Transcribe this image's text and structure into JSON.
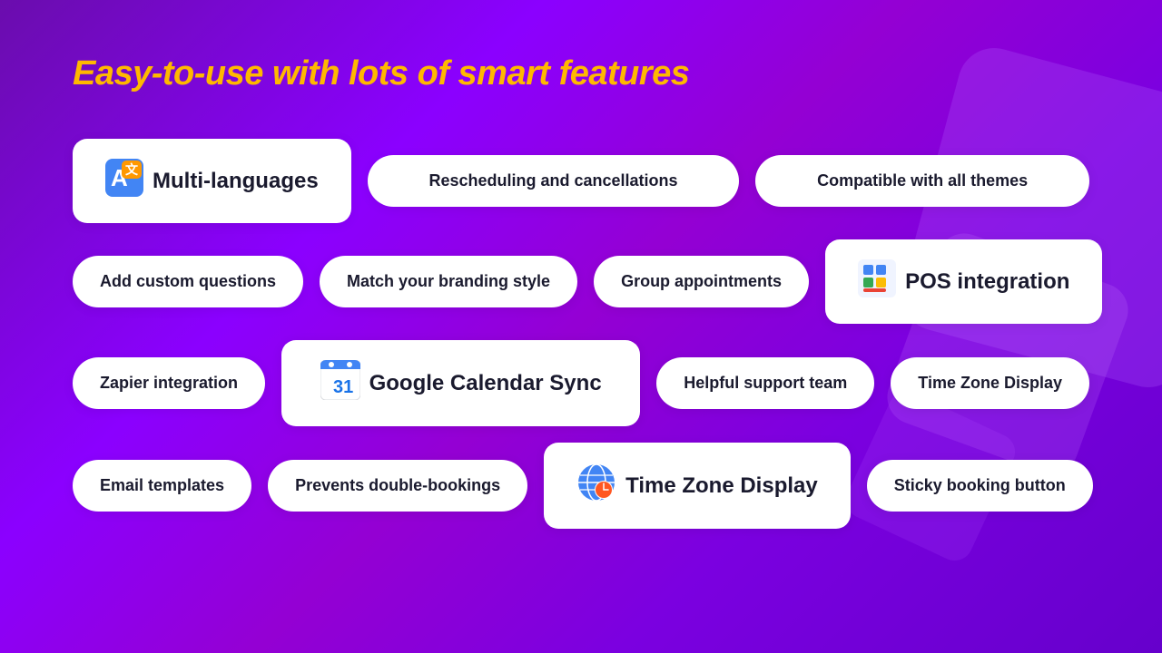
{
  "page": {
    "title": "Easy-to-use with lots of smart features"
  },
  "features": {
    "row1": [
      {
        "id": "multi-languages",
        "label": "Multi-languages",
        "icon": "translate",
        "large": true
      },
      {
        "id": "rescheduling",
        "label": "Rescheduling and cancellations",
        "icon": null,
        "large": false
      },
      {
        "id": "compatible-themes",
        "label": "Compatible with all themes",
        "icon": null,
        "large": false
      }
    ],
    "row2": [
      {
        "id": "custom-questions",
        "label": "Add custom questions",
        "icon": null,
        "large": false
      },
      {
        "id": "branding",
        "label": "Match your branding style",
        "icon": null,
        "large": false
      },
      {
        "id": "group-appointments",
        "label": "Group appointments",
        "icon": null,
        "large": false
      },
      {
        "id": "pos-integration",
        "label": "POS integration",
        "icon": "pos",
        "large": true
      }
    ],
    "row3": [
      {
        "id": "zapier",
        "label": "Zapier integration",
        "icon": null,
        "large": false
      },
      {
        "id": "gcal",
        "label": "Google Calendar Sync",
        "icon": "gcal",
        "large": true
      },
      {
        "id": "support",
        "label": "Helpful support team",
        "icon": null,
        "large": false
      },
      {
        "id": "timezone-sm",
        "label": "Time Zone Display",
        "icon": null,
        "large": false
      }
    ],
    "row4": [
      {
        "id": "email-templates",
        "label": "Email templates",
        "icon": null,
        "large": false
      },
      {
        "id": "double-bookings",
        "label": "Prevents double-bookings",
        "icon": null,
        "large": false
      },
      {
        "id": "timezone-lg",
        "label": "Time Zone Display",
        "icon": "globe",
        "large": true
      },
      {
        "id": "sticky-booking",
        "label": "Sticky booking button",
        "icon": null,
        "large": false
      }
    ]
  }
}
